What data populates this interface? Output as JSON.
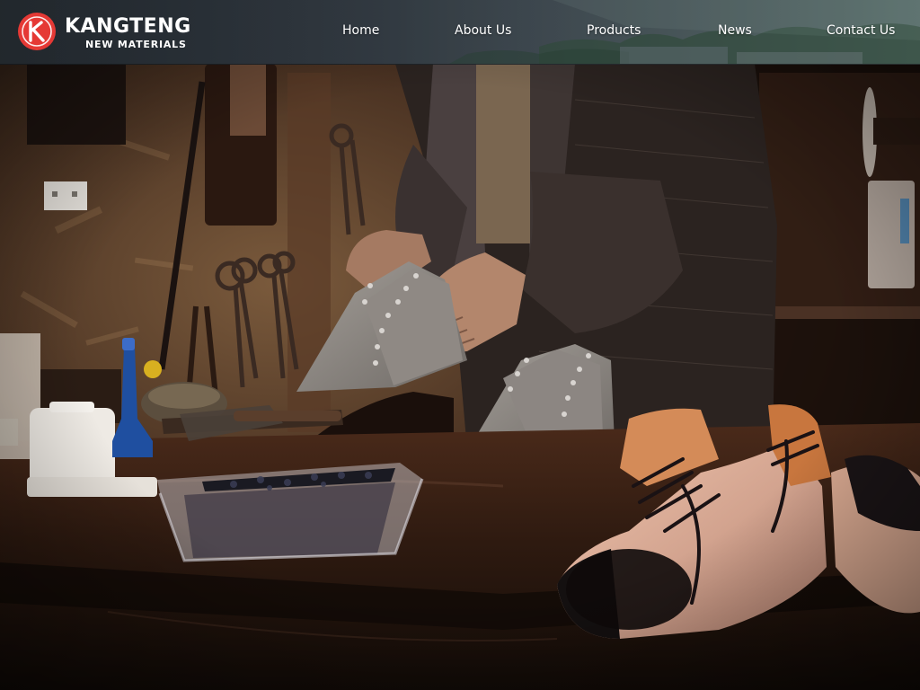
{
  "brand": {
    "name": "KANGTENG",
    "subtitle": "NEW MATERIALS",
    "badge_letter": "K",
    "badge_color": "#e53935"
  },
  "nav": {
    "items": [
      {
        "label": "Home"
      },
      {
        "label": "About Us"
      },
      {
        "label": "Products"
      },
      {
        "label": "News"
      },
      {
        "label": "Contact Us"
      }
    ]
  },
  "hero": {
    "scene_icon": "shoemaker-workshop-photo"
  },
  "colors": {
    "header_bg": "#2c343c",
    "nav_text": "#ffffff",
    "brand_red": "#e53935",
    "felt_grey": "#8a8580",
    "counter_brown": "#3a2014"
  }
}
